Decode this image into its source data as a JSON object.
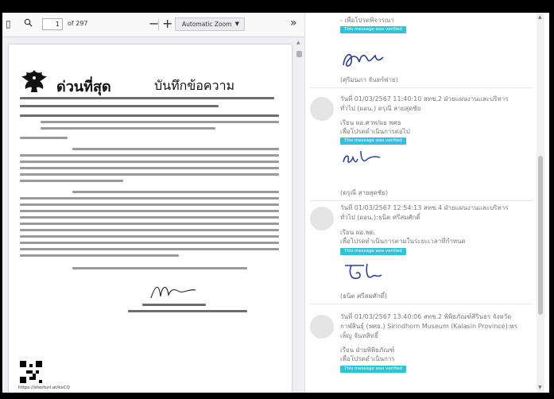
{
  "pdf_viewer": {
    "page_current": "1",
    "page_total": "of 297",
    "zoom_label": "Automatic Zoom",
    "document": {
      "title_urgent": "ด่วนที่สุด",
      "title_memo": "บันทึกข้อความ",
      "qr_url": "https://shorturl.at/kxCQ"
    }
  },
  "chat": {
    "top_fragment": "- เพื่อโปรดพิจารณา",
    "verified_label": "This message was verified",
    "messages": [
      {
        "sig_caption": "(ศุริมนภา จันทร์พ่าย)"
      },
      {
        "timestamp": "วันที่ 01/03/2567 11:40:10 สทช.2 ฝ่ายแผนงานและบริหารทั่วไป (ผอน.) ดรุณี สายสุดชัย",
        "body1": "เรียน ผอ.ศวพ/ผอ พศธ",
        "body2": "เพื่อโปรดดำเนินการต่อไป",
        "sig_caption": "(ดรุณี สายสุดชัย)"
      },
      {
        "timestamp": "วันที่ 01/03/2567 12:54:13 สทช.4 ฝ่ายแผนงานและบริหารทั่วไป (ผอน.):ธนิต ศรีสมศักดิ์",
        "body1": "เรียน ผอ.พด.",
        "body2": "เพื่อโปรดดำเนินการตามในระยะเวลาที่กำหนด",
        "sig_caption": "(ธนิต ศรีสมศักดิ์)"
      },
      {
        "timestamp": "วันที่ 01/03/2567 13:40:06 สทช.2 พิพิธภัณฑ์สิรินธร จังหวัดกาฬสินธุ์ (พศธ.) Sirindhorn Museum (Kalasin Province):พรเพ็ญ จันทสิทธิ์",
        "body1": "เรียน ฝ่ายพิพิธภัณฑ์",
        "body2": "เพื่อโปรดดำเนินการ"
      }
    ]
  }
}
